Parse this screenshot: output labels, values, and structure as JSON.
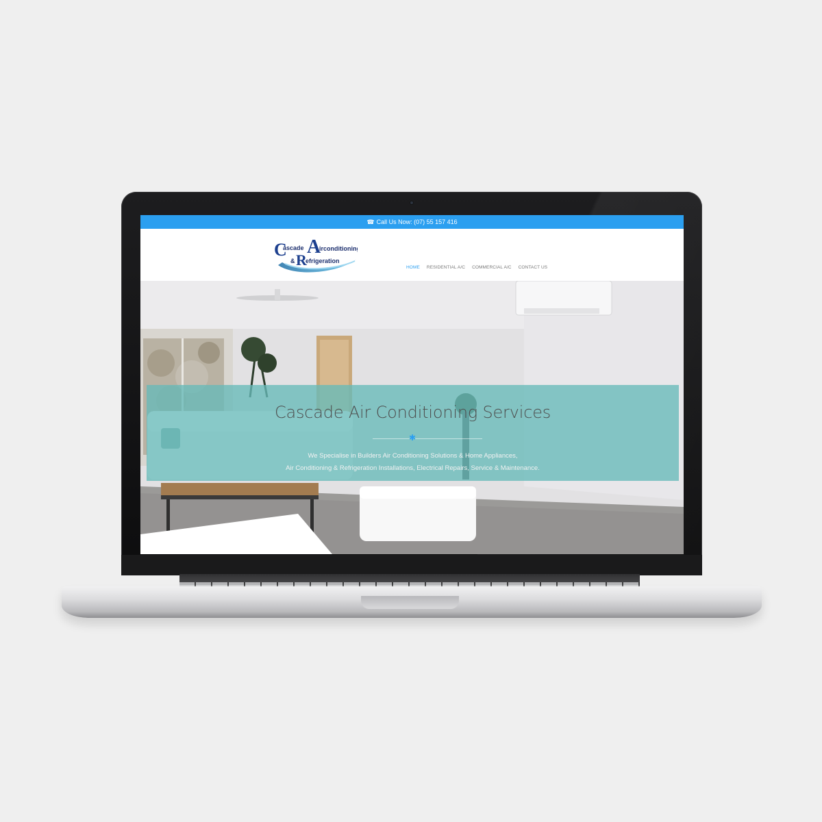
{
  "topbar": {
    "phone_icon": "phone-icon",
    "call_text": "Call Us Now: (07) 55 157 416"
  },
  "logo": {
    "line1_a": "ascade",
    "line1_b": "irconditioning",
    "line2_a": "&",
    "line2_b": "efrigeration",
    "initial_c": "C",
    "initial_a": "A",
    "initial_r": "R"
  },
  "nav": {
    "items": [
      {
        "label": "HOME",
        "active": true
      },
      {
        "label": "RESIDENTIAL A/C",
        "active": false
      },
      {
        "label": "COMMERCIAL A/C",
        "active": false
      },
      {
        "label": "CONTACT US",
        "active": false
      }
    ]
  },
  "hero": {
    "title": "Cascade Air Conditioning Services",
    "divider_icon": "snowflake-icon",
    "subtitle_line1": "We Specialise in Builders Air Conditioning Solutions & Home Appliances,",
    "subtitle_line2": "Air Conditioning & Refrigeration Installations, Electrical Repairs, Service & Maintenance."
  },
  "colors": {
    "accent": "#2b9ff0",
    "overlay": "#67bab8",
    "background": "#efefef"
  }
}
